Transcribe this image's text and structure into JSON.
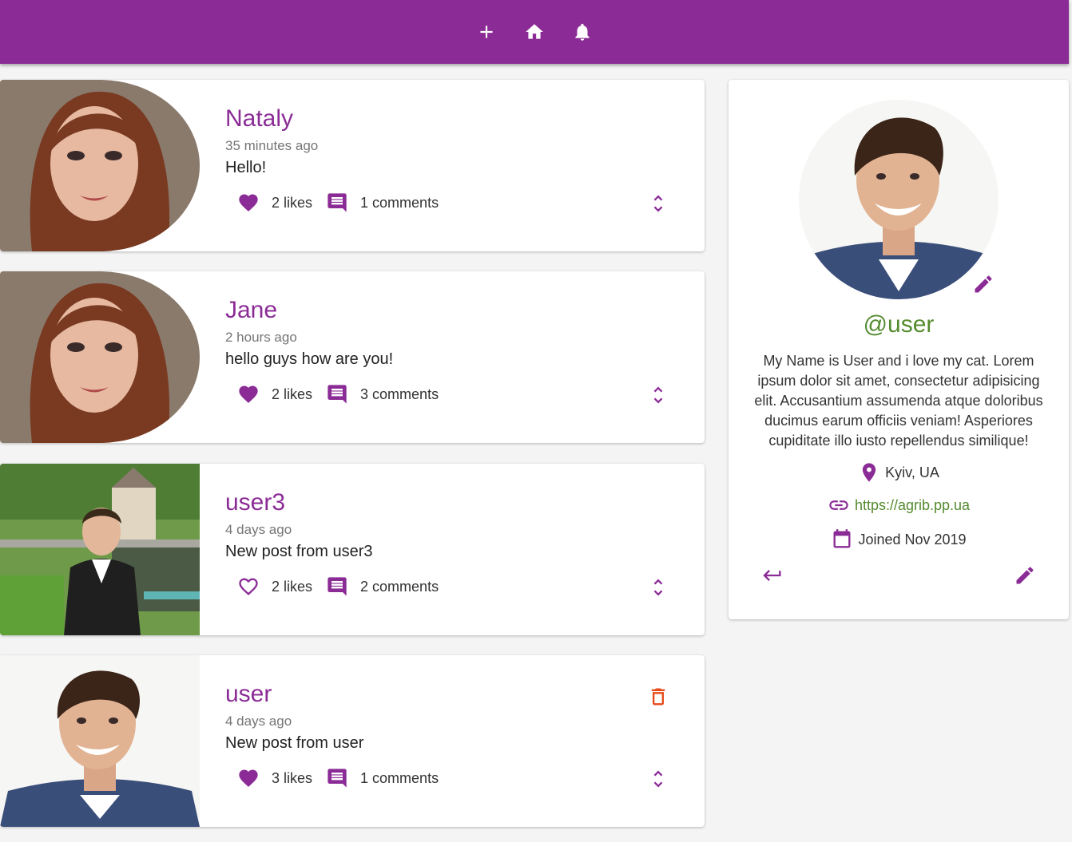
{
  "appbar": {
    "icons": [
      "add-icon",
      "home-icon",
      "bell-icon"
    ],
    "color": "#8b2c96"
  },
  "posts": [
    {
      "author": "Nataly",
      "time": "35 minutes ago",
      "body": "Hello!",
      "likes": "2 likes",
      "comments": "1 comments",
      "liked": true
    },
    {
      "author": "Jane",
      "time": "2 hours ago",
      "body": "hello guys how are you!",
      "likes": "2 likes",
      "comments": "3 comments",
      "liked": true
    },
    {
      "author": "user3",
      "time": "4 days ago",
      "body": "New post from user3",
      "likes": "2 likes",
      "comments": "2 comments",
      "liked": false
    },
    {
      "author": "user",
      "time": "4 days ago",
      "body": "New post from user",
      "likes": "3 likes",
      "comments": "1 comments",
      "liked": true,
      "deletable": true
    }
  ],
  "profile": {
    "handle": "@user",
    "bio": "My Name is User and i love my cat. Lorem ipsum dolor sit amet, consectetur adipisicing elit. Accusantium assumenda atque doloribus ducimus earum officiis veniam! Asperiores cupiditate illo iusto repellendus similique!",
    "location": "Kyiv, UA",
    "website": "https://agrib.pp.ua",
    "joined": "Joined Nov 2019"
  },
  "colors": {
    "accent": "#8b2c96",
    "link_green": "#558b2f",
    "delete": "#e64a19",
    "background": "#f4f4f4"
  }
}
